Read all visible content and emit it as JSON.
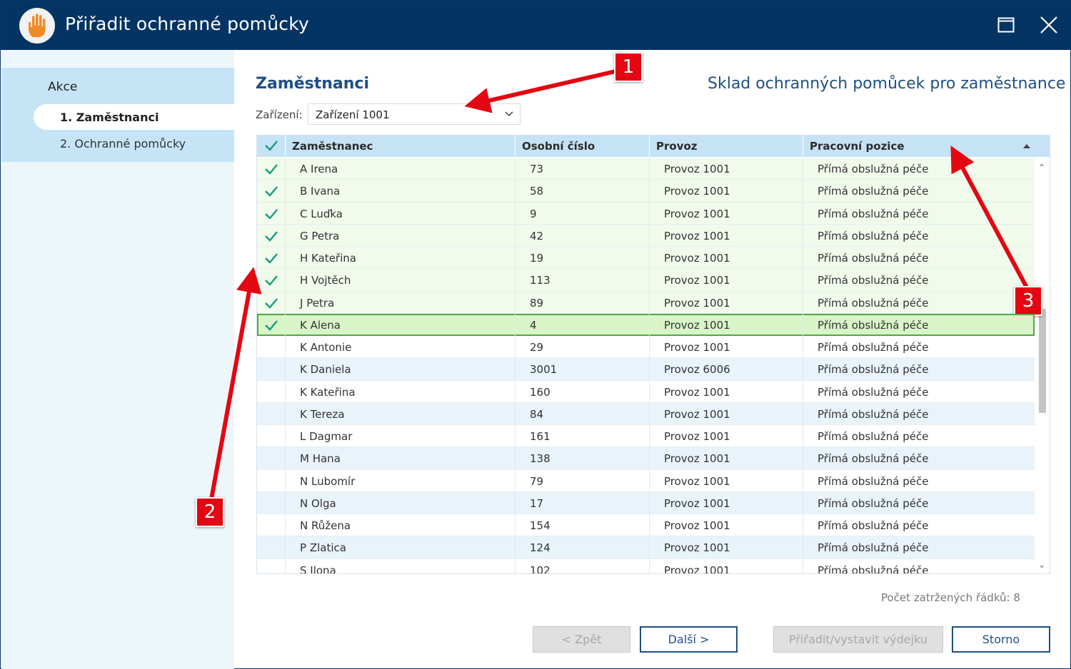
{
  "window": {
    "title": "Přiřadit ochranné pomůcky",
    "icon": "hand-icon"
  },
  "sidebar": {
    "heading": "Akce",
    "items": [
      {
        "label": "1. Zaměstnanci",
        "active": true
      },
      {
        "label": "2. Ochranné pomůcky",
        "active": false
      }
    ]
  },
  "main": {
    "title": "Zaměstnanci",
    "subtitle": "Sklad ochranných pomůcek pro zaměstnance",
    "facility_label": "Zařízení:",
    "facility_value": "Zařízení 1001"
  },
  "grid": {
    "columns": [
      "Zaměstnanec",
      "Osobní číslo",
      "Provoz",
      "Pracovní pozice"
    ],
    "sorted_column": "Pracovní pozice",
    "sort_direction": "ascending",
    "rows": [
      {
        "checked": true,
        "name": "A Irena",
        "number": "73",
        "operation": "Provoz 1001",
        "position": "Přímá obslužná péče"
      },
      {
        "checked": true,
        "name": "B Ivana",
        "number": "58",
        "operation": "Provoz 1001",
        "position": "Přímá obslužná péče"
      },
      {
        "checked": true,
        "name": "C Luďka",
        "number": "9",
        "operation": "Provoz 1001",
        "position": "Přímá obslužná péče"
      },
      {
        "checked": true,
        "name": "G Petra",
        "number": "42",
        "operation": "Provoz 1001",
        "position": "Přímá obslužná péče"
      },
      {
        "checked": true,
        "name": "H Kateřina",
        "number": "19",
        "operation": "Provoz 1001",
        "position": "Přímá obslužná péče"
      },
      {
        "checked": true,
        "name": "H Vojtěch",
        "number": "113",
        "operation": "Provoz 1001",
        "position": "Přímá obslužná péče"
      },
      {
        "checked": true,
        "name": "J Petra",
        "number": "89",
        "operation": "Provoz 1001",
        "position": "Přímá obslužná péče"
      },
      {
        "checked": true,
        "name": "K Alena",
        "number": "4",
        "operation": "Provoz 1001",
        "position": "Přímá obslužná péče",
        "selected": true
      },
      {
        "checked": false,
        "name": "K Antonie",
        "number": "29",
        "operation": "Provoz 1001",
        "position": "Přímá obslužná péče"
      },
      {
        "checked": false,
        "name": "K Daniela",
        "number": "3001",
        "operation": "Provoz 6006",
        "position": "Přímá obslužná péče"
      },
      {
        "checked": false,
        "name": "K Kateřina",
        "number": "160",
        "operation": "Provoz 1001",
        "position": "Přímá obslužná péče"
      },
      {
        "checked": false,
        "name": "K Tereza",
        "number": "84",
        "operation": "Provoz 1001",
        "position": "Přímá obslužná péče"
      },
      {
        "checked": false,
        "name": "L Dagmar",
        "number": "161",
        "operation": "Provoz 1001",
        "position": "Přímá obslužná péče"
      },
      {
        "checked": false,
        "name": "M Hana",
        "number": "138",
        "operation": "Provoz 1001",
        "position": "Přímá obslužná péče"
      },
      {
        "checked": false,
        "name": "N Lubomír",
        "number": "79",
        "operation": "Provoz 1001",
        "position": "Přímá obslužná péče"
      },
      {
        "checked": false,
        "name": "N Olga",
        "number": "17",
        "operation": "Provoz 1001",
        "position": "Přímá obslužná péče"
      },
      {
        "checked": false,
        "name": "N Růžena",
        "number": "154",
        "operation": "Provoz 1001",
        "position": "Přímá obslužná péče"
      },
      {
        "checked": false,
        "name": "P Zlatica",
        "number": "124",
        "operation": "Provoz 1001",
        "position": "Přímá obslužná péče"
      },
      {
        "checked": false,
        "name": "S Ilona",
        "number": "102",
        "operation": "Provoz 1001",
        "position": "Přímá obslužná péče"
      }
    ]
  },
  "footer": {
    "checked_count_text": "Počet zatržených řádků: 8",
    "buttons": {
      "back": "< Zpět",
      "next": "Další >",
      "assign": "Přiřadit/vystavit výdejku",
      "cancel": "Storno"
    }
  },
  "annotations": {
    "badges": [
      "1",
      "2",
      "3"
    ],
    "color": "#e30613"
  },
  "colors": {
    "titlebar": "#043463",
    "accent": "#1d4f86",
    "check": "#1a9a7e",
    "selected_row": "#d8f5c8",
    "selected_border": "#55a643"
  }
}
